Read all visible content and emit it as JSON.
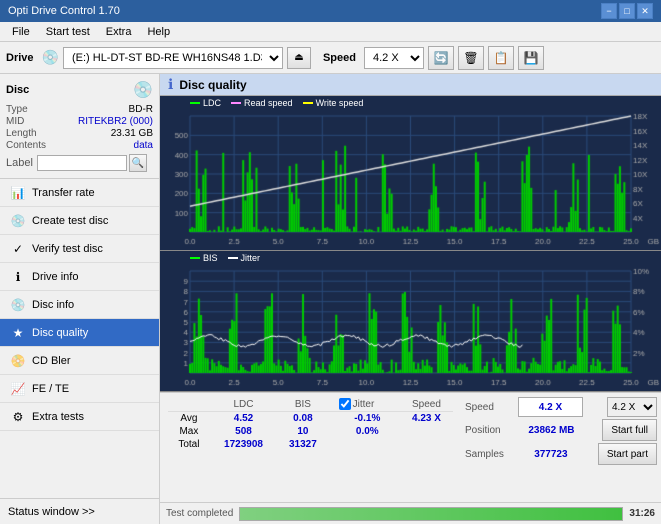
{
  "titleBar": {
    "title": "Opti Drive Control 1.70",
    "minimize": "−",
    "maximize": "□",
    "close": "✕"
  },
  "menuBar": {
    "items": [
      "File",
      "Start test",
      "Extra",
      "Help"
    ]
  },
  "driveBar": {
    "label": "Drive",
    "driveValue": "(E:) HL-DT-ST BD-RE  WH16NS48 1.D3",
    "speedLabel": "Speed",
    "speedValue": "4.2 X"
  },
  "disc": {
    "title": "Disc",
    "typeLabel": "Type",
    "typeValue": "BD-R",
    "midLabel": "MID",
    "midValue": "RITEKBR2 (000)",
    "lengthLabel": "Length",
    "lengthValue": "23.31 GB",
    "contentsLabel": "Contents",
    "contentsValue": "data",
    "labelLabel": "Label",
    "labelPlaceholder": ""
  },
  "navItems": [
    {
      "id": "transfer-rate",
      "label": "Transfer rate",
      "icon": "📊"
    },
    {
      "id": "create-test-disc",
      "label": "Create test disc",
      "icon": "💿"
    },
    {
      "id": "verify-test-disc",
      "label": "Verify test disc",
      "icon": "✓"
    },
    {
      "id": "drive-info",
      "label": "Drive info",
      "icon": "ℹ"
    },
    {
      "id": "disc-info",
      "label": "Disc info",
      "icon": "💿"
    },
    {
      "id": "disc-quality",
      "label": "Disc quality",
      "icon": "★",
      "active": true
    },
    {
      "id": "cd-bler",
      "label": "CD Bler",
      "icon": "📀"
    },
    {
      "id": "fe-te",
      "label": "FE / TE",
      "icon": "📈"
    },
    {
      "id": "extra-tests",
      "label": "Extra tests",
      "icon": "⚙"
    }
  ],
  "statusWindow": {
    "label": "Status window >>"
  },
  "discQuality": {
    "title": "Disc quality",
    "legend": {
      "ldc": "LDC",
      "readSpeed": "Read speed",
      "writeSpeed": "Write speed",
      "bis": "BIS",
      "jitter": "Jitter"
    }
  },
  "chart1": {
    "yMax": 600,
    "yRight": 18,
    "yLabels": [
      100,
      200,
      300,
      400,
      500
    ],
    "yRightLabels": [
      "4X",
      "6X",
      "8X",
      "10X",
      "12X",
      "14X",
      "16X",
      "18X"
    ],
    "xMax": 25.0,
    "xLabels": [
      "0.0",
      "2.5",
      "5.0",
      "7.5",
      "10.0",
      "12.5",
      "15.0",
      "17.5",
      "20.0",
      "22.5",
      "25.0"
    ]
  },
  "chart2": {
    "yMax": 10,
    "yRight": 10,
    "yRightLabels": [
      "2%",
      "4%",
      "6%",
      "8%",
      "10%"
    ],
    "yLabels": [
      1,
      2,
      3,
      4,
      5,
      6,
      7,
      8,
      9
    ],
    "xMax": 25.0,
    "xLabels": [
      "0.0",
      "2.5",
      "5.0",
      "7.5",
      "10.0",
      "12.5",
      "15.0",
      "17.5",
      "20.0",
      "22.5",
      "25.0"
    ]
  },
  "statsTable": {
    "headers": [
      "",
      "LDC",
      "BIS",
      "",
      "Jitter",
      "Speed"
    ],
    "rows": [
      {
        "label": "Avg",
        "ldc": "4.52",
        "bis": "0.08",
        "jitter": "-0.1%",
        "speed": "4.23 X"
      },
      {
        "label": "Max",
        "ldc": "508",
        "bis": "10",
        "jitter": "0.0%"
      },
      {
        "label": "Total",
        "ldc": "1723908",
        "bis": "31327"
      }
    ],
    "jitterChecked": true,
    "jitterLabel": "Jitter"
  },
  "rightStats": {
    "speedLabel": "Speed",
    "speedValue": "4.2 X",
    "positionLabel": "Position",
    "positionValue": "23862 MB",
    "samplesLabel": "Samples",
    "samplesValue": "377723",
    "startFullLabel": "Start full",
    "startPartLabel": "Start part"
  },
  "bottomStatus": {
    "text": "Test completed",
    "progress": 100,
    "time": "31:26"
  }
}
